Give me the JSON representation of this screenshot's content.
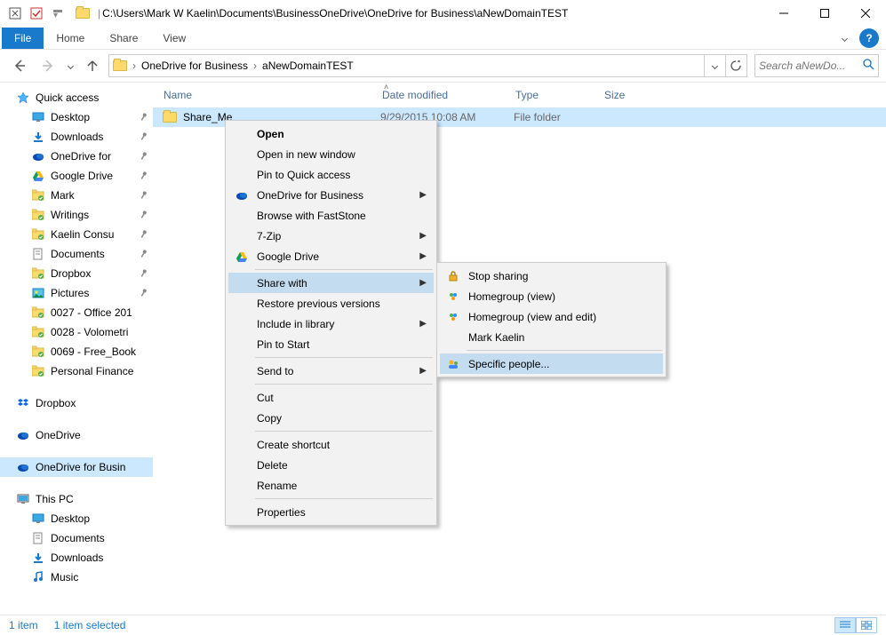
{
  "title_path": "C:\\Users\\Mark W Kaelin\\Documents\\BusinessOneDrive\\OneDrive for Business\\aNewDomainTEST",
  "ribbon": {
    "file": "File",
    "tabs": [
      "Home",
      "Share",
      "View"
    ]
  },
  "breadcrumbs": [
    "OneDrive for Business",
    "aNewDomainTEST"
  ],
  "search_placeholder": "Search aNewDo...",
  "columns": {
    "name": "Name",
    "date": "Date modified",
    "type": "Type",
    "size": "Size"
  },
  "rows": [
    {
      "name": "Share_Me",
      "date": "9/29/2015 10:08 AM",
      "type": "File folder",
      "size": ""
    }
  ],
  "sidebar": {
    "quick_access": {
      "label": "Quick access",
      "items": [
        {
          "label": "Desktop",
          "pinned": true,
          "icon": "desktop"
        },
        {
          "label": "Downloads",
          "pinned": true,
          "icon": "downloads"
        },
        {
          "label": "OneDrive for",
          "pinned": true,
          "icon": "onedrive"
        },
        {
          "label": "Google Drive",
          "pinned": true,
          "icon": "gdrive"
        },
        {
          "label": "Mark",
          "pinned": true,
          "icon": "folder-green"
        },
        {
          "label": "Writings",
          "pinned": true,
          "icon": "folder-green"
        },
        {
          "label": "Kaelin Consu",
          "pinned": true,
          "icon": "folder-green"
        },
        {
          "label": "Documents",
          "pinned": true,
          "icon": "documents"
        },
        {
          "label": "Dropbox",
          "pinned": true,
          "icon": "folder-green"
        },
        {
          "label": "Pictures",
          "pinned": true,
          "icon": "pictures"
        },
        {
          "label": "0027 - Office 201",
          "pinned": false,
          "icon": "folder-green"
        },
        {
          "label": "0028 - Volometri",
          "pinned": false,
          "icon": "folder-green"
        },
        {
          "label": "0069 - Free_Book",
          "pinned": false,
          "icon": "folder-green"
        },
        {
          "label": "Personal Finance",
          "pinned": false,
          "icon": "folder-green"
        }
      ]
    },
    "sections": [
      {
        "label": "Dropbox",
        "icon": "dropbox"
      },
      {
        "label": "OneDrive",
        "icon": "onedrive"
      },
      {
        "label": "OneDrive for Busin",
        "icon": "onedrive",
        "selected": true
      },
      {
        "label": "This PC",
        "icon": "thispc"
      }
    ],
    "thispc": [
      {
        "label": "Desktop",
        "icon": "desktop"
      },
      {
        "label": "Documents",
        "icon": "documents"
      },
      {
        "label": "Downloads",
        "icon": "downloads"
      },
      {
        "label": "Music",
        "icon": "music"
      }
    ]
  },
  "status": {
    "left": "1 item",
    "right": "1 item selected"
  },
  "context_menu": [
    {
      "label": "Open",
      "type": "item",
      "default": true
    },
    {
      "label": "Open in new window",
      "type": "item"
    },
    {
      "label": "Pin to Quick access",
      "type": "item"
    },
    {
      "label": "OneDrive for Business",
      "type": "submenu",
      "icon": "onedrive"
    },
    {
      "label": "Browse with FastStone",
      "type": "item"
    },
    {
      "label": "7-Zip",
      "type": "submenu"
    },
    {
      "label": "Google Drive",
      "type": "submenu",
      "icon": "gdrive"
    },
    {
      "type": "sep"
    },
    {
      "label": "Share with",
      "type": "submenu",
      "highlight": true
    },
    {
      "label": "Restore previous versions",
      "type": "item"
    },
    {
      "label": "Include in library",
      "type": "submenu"
    },
    {
      "label": "Pin to Start",
      "type": "item"
    },
    {
      "type": "sep"
    },
    {
      "label": "Send to",
      "type": "submenu"
    },
    {
      "type": "sep"
    },
    {
      "label": "Cut",
      "type": "item"
    },
    {
      "label": "Copy",
      "type": "item"
    },
    {
      "type": "sep"
    },
    {
      "label": "Create shortcut",
      "type": "item"
    },
    {
      "label": "Delete",
      "type": "item"
    },
    {
      "label": "Rename",
      "type": "item"
    },
    {
      "type": "sep"
    },
    {
      "label": "Properties",
      "type": "item"
    }
  ],
  "sub_menu": [
    {
      "label": "Stop sharing",
      "icon": "lock"
    },
    {
      "label": "Homegroup (view)",
      "icon": "homegroup"
    },
    {
      "label": "Homegroup (view and edit)",
      "icon": "homegroup"
    },
    {
      "label": "Mark Kaelin",
      "icon": ""
    },
    {
      "type": "sep"
    },
    {
      "label": "Specific people...",
      "icon": "people",
      "highlight": true
    }
  ]
}
